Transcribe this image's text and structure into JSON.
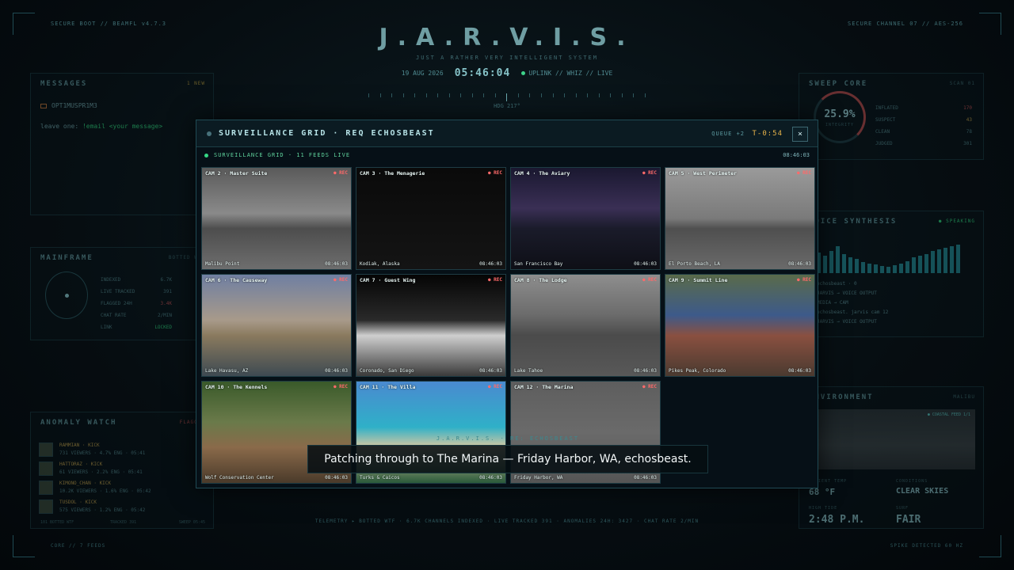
{
  "hud": {
    "top_left_tiny": "SECURE BOOT // BEAMFL v4.7.3",
    "top_right_tiny": "SECURE CHANNEL 07 // AES-256",
    "title": "J.A.R.V.I.S.",
    "subtitle": "JUST A RATHER VERY INTELLIGENT SYSTEM",
    "date": "19 AUG 2026",
    "clock": "05:46:04",
    "uplink": "UPLINK // WHIZ // LIVE",
    "heading": "HDG 217°",
    "bottom_left_tiny": "CORE // 7 FEEDS",
    "bottom_right_tiny": "SPIKE DETECTED 60 HZ"
  },
  "messages": {
    "title": "MESSAGES",
    "tag": "1 NEW",
    "sender": "OPT1MUSPR1M3",
    "line_prefix": "leave one: ",
    "line_accent": "!email <your message>"
  },
  "mainframe": {
    "title": "MAINFRAME",
    "tag": "BOTTED WTF",
    "rows": [
      {
        "label": "INDEXED",
        "value": "6.7K"
      },
      {
        "label": "LIVE TRACKED",
        "value": "391"
      },
      {
        "label": "FLAGGED 24H",
        "value": "3.4K"
      },
      {
        "label": "CHAT RATE",
        "value": "2/MIN"
      },
      {
        "label": "LINK",
        "value": "LOCKED"
      }
    ]
  },
  "anomaly": {
    "title": "ANOMALY WATCH",
    "tag": "FLAGGED",
    "rows": [
      {
        "name": "RAMMIAN · KICK",
        "stats": "731 VIEWERS · 4.7% ENG · 05:41"
      },
      {
        "name": "HATTORAZ · KICK",
        "stats": "61 VIEWERS · 2.2% ENG · 05:41"
      },
      {
        "name": "KIMONO_CHAN · KICK",
        "stats": "10.2K VIEWERS · 1.6% ENG · 05:42"
      },
      {
        "name": "TUSDOL · KICK",
        "stats": "575 VIEWERS · 1.2% ENG · 05:42"
      }
    ],
    "footer_left": "101 BOTTED WTF",
    "footer_mid": "TRACKED 391",
    "footer_right": "SWEEP 05:45"
  },
  "sweep": {
    "title": "SWEEP CORE",
    "tag": "SCAN 01",
    "integrity_value": "25.9%",
    "integrity_label": "INTEGRITY",
    "rows": [
      {
        "label": "INFLATED",
        "value": "170"
      },
      {
        "label": "SUSPECT",
        "value": "43"
      },
      {
        "label": "CLEAN",
        "value": "78"
      },
      {
        "label": "JUDGED",
        "value": "301"
      }
    ]
  },
  "voice": {
    "title": "VOICE SYNTHESIS",
    "tag": "● SPEAKING",
    "bar_levels": [
      0.65,
      0.55,
      0.7,
      0.85,
      0.6,
      0.5,
      0.45,
      0.35,
      0.3,
      0.28,
      0.22,
      0.2,
      0.25,
      0.3,
      0.38,
      0.5,
      0.55,
      0.6,
      0.7,
      0.75,
      0.8,
      0.85,
      0.9
    ],
    "lines": [
      "echosbeast · 0",
      "JARVIS → VOICE OUTPUT",
      "MEDIA → CAM",
      "echosbeast. jarvis cam 12",
      "JARVIS → VOICE OUTPUT"
    ]
  },
  "environment": {
    "title": "ENVIRONMENT",
    "tag": "MALIBU",
    "feed_tag": "● COASTAL FEED 1/1",
    "ambient_label": "AMBIENT TEMP",
    "ambient_value": "68 °F",
    "conditions_label": "CONDITIONS",
    "conditions_value": "CLEAR SKIES",
    "time_label": "HIGH TIDE",
    "time_value": "2:48 P.M.",
    "surf_label": "SURF",
    "surf_value": "FAIR"
  },
  "ticker": "TELEMETRY ▸  BOTTED WTF  ·  6.7K CHANNELS INDEXED  ·  LIVE TRACKED 391  ·  ANOMALIES 24H: 3427  ·  CHAT RATE 2/MIN",
  "modal": {
    "title": "SURVEILLANCE GRID · REQ ECHOSBEAST",
    "queue": "QUEUE +2",
    "timer": "T-0:54",
    "close": "×",
    "status": "SURVEILLANCE GRID · 11 FEEDS LIVE",
    "status_time": "08:46:03",
    "cams": [
      {
        "name": "CAM 2 · Master Suite",
        "rec": "● REC",
        "location": "Malibu Point",
        "time": "08:46:03",
        "bg": "linear-gradient(180deg,#5a5a5a 0%,#8a8a8a 45%,#4d4d4d 60%,#6e6e6e 100%)"
      },
      {
        "name": "CAM 3 · The Menagerie",
        "rec": "● REC",
        "location": "Kodiak, Alaska",
        "time": "08:46:03",
        "bg": "linear-gradient(180deg,#0a0a0a 0%,#141414 100%)"
      },
      {
        "name": "CAM 4 · The Aviary",
        "rec": "● REC",
        "location": "San Francisco Bay",
        "time": "08:46:03",
        "bg": "linear-gradient(180deg,#1a1830 0%,#3a2f55 40%,#1a1b2a 60%,#0e0f16 100%)"
      },
      {
        "name": "CAM 5 · West Perimeter",
        "rec": "● REC",
        "location": "El Porto Beach, LA",
        "time": "08:46:03",
        "bg": "linear-gradient(180deg,#9a9a9a 0%,#7a7a7a 50%,#4f4f4f 60%,#6a6a6a 100%)"
      },
      {
        "name": "CAM 6 · The Causeway",
        "rec": "● REC",
        "location": "Lake Havasu, AZ",
        "time": "08:46:03",
        "bg": "linear-gradient(180deg,#6f7fa2 0%,#a89a8a 45%,#8a7a5e 60%,#3e4a52 100%)"
      },
      {
        "name": "CAM 7 · Guest Wing",
        "rec": "● REC",
        "location": "Coronado, San Diego",
        "time": "08:46:03",
        "bg": "linear-gradient(180deg,#050505 0%,#2a2a2a 45%,#cfcfcf 60%,#3a3a3a 100%)"
      },
      {
        "name": "CAM 8 · The Lodge",
        "rec": "● REC",
        "location": "Lake Tahoe",
        "time": "08:46:03",
        "bg": "linear-gradient(180deg,#8e8e8e 0%,#6b6b6b 40%,#4b4b4b 60%,#585858 100%)"
      },
      {
        "name": "CAM 9 · Summit Line",
        "rec": "● REC",
        "location": "Pikes Peak, Colorado",
        "time": "08:46:03",
        "bg": "linear-gradient(180deg,#5a6b4a 0%,#3d5a8a 40%,#8a5040 60%,#4a3a30 100%)"
      },
      {
        "name": "CAM 10 · The Kennels",
        "rec": "● REC",
        "location": "Wolf Conservation Center",
        "time": "08:46:03",
        "bg": "linear-gradient(180deg,#3a5a2a 0%,#6a7a4a 40%,#8a6a4a 65%,#4a3a2a 100%)"
      },
      {
        "name": "CAM 11 · The Villa",
        "rec": "● REC",
        "location": "Turks & Caicos",
        "time": "08:46:03",
        "bg": "linear-gradient(180deg,#4a8ad0 0%,#2fb0c8 45%,#d8c8a0 65%,#2a5a3a 100%)"
      },
      {
        "name": "CAM 12 · The Marina",
        "rec": "● REC",
        "location": "Friday Harbor, WA",
        "time": "08:46:03",
        "bg": "linear-gradient(180deg,#5e5e5e 0%,#6a6a6a 50%,#555555 100%)"
      }
    ]
  },
  "subtitle": {
    "tag": "J.A.R.V.I.S. · RE: ECHOSBEAST",
    "text": "Patching through to The Marina — Friday Harbor, WA, echosbeast."
  },
  "colors": {
    "accent": "#2fd37a",
    "rec": "#ff6a6a",
    "timer": "#e7b34a",
    "panel_border": "#17343a"
  }
}
